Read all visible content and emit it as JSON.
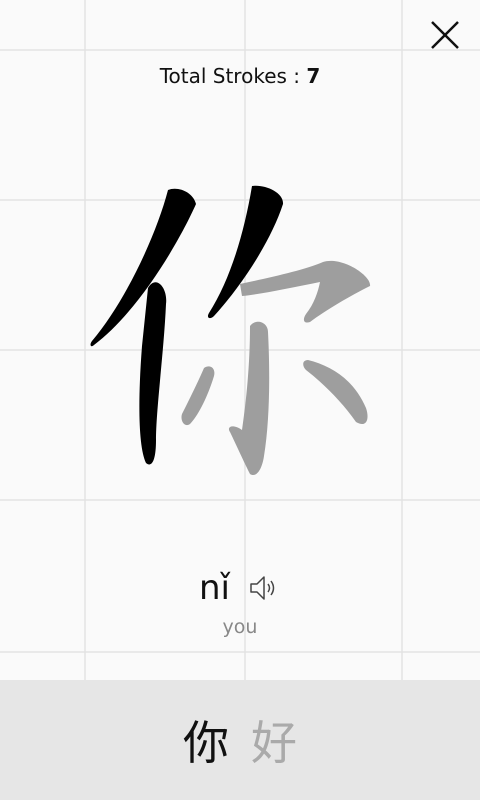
{
  "header": {
    "title_label": "Total Strokes : ",
    "total_strokes": "7"
  },
  "close_icon": "close-icon",
  "character": "你",
  "pronunciation": {
    "pinyin": "nǐ",
    "speaker_icon": "speaker-icon"
  },
  "meaning": "you",
  "word": {
    "chars": [
      "你",
      "好"
    ],
    "active_index": 0
  },
  "colors": {
    "drawn_stroke": "#000000",
    "pending_stroke": "#9e9e9e",
    "grid_line": "#e3e3e3",
    "bottom_bar": "#e6e6e6"
  }
}
